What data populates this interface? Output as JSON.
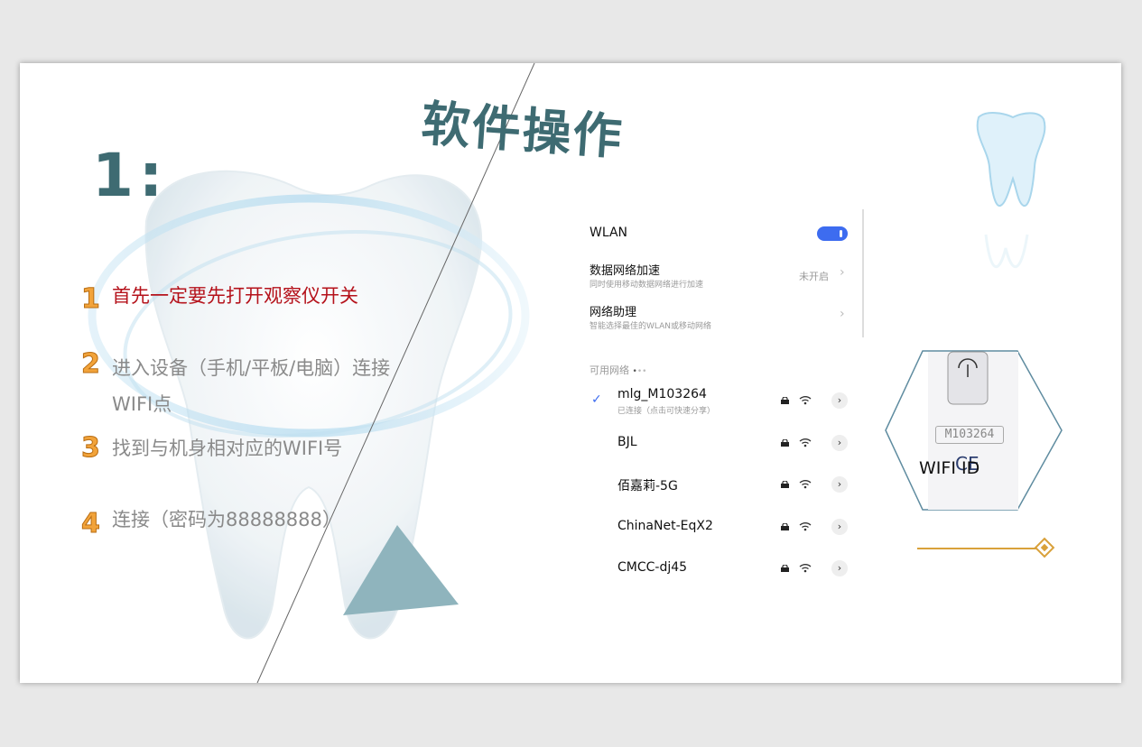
{
  "slide": {
    "step_number": "1:",
    "title": "软件操作"
  },
  "steps": [
    {
      "number": "1",
      "text": "首先一定要先打开观察仪开关"
    },
    {
      "number": "2",
      "text_line1": "进入设备（手机/平板/电脑）连接",
      "text_line2": "WIFI点"
    },
    {
      "number": "3",
      "text": "找到与机身相对应的WIFI号"
    },
    {
      "number": "4",
      "text": "连接（密码为88888888）"
    }
  ],
  "wlan_panel": {
    "wlan_label": "WLAN",
    "wlan_enabled": true,
    "data_accel_title": "数据网络加速",
    "data_accel_sub": "同时使用移动数据网络进行加速",
    "data_accel_status": "未开启",
    "assistant_title": "网络助理",
    "assistant_sub": "智能选择最佳的WLAN或移动网络",
    "available_label": "可用网络",
    "networks": [
      {
        "name": "mlg_M103264",
        "sub": "已连接（点击可快速分享）",
        "connected": true
      },
      {
        "name": "BJL",
        "sub": "",
        "connected": false
      },
      {
        "name": "佰嘉莉-5G",
        "sub": "",
        "connected": false
      },
      {
        "name": "ChinaNet-EqX2",
        "sub": "",
        "connected": false
      },
      {
        "name": "CMCC-dj45",
        "sub": "",
        "connected": false
      }
    ]
  },
  "device": {
    "serial_label": "M103264",
    "ce_mark": "CE",
    "caption": "WIFI ID"
  },
  "colors": {
    "title": "#3e6b72",
    "highlight_step": "#b5121b",
    "toggle": "#3d6cf0",
    "accent_line": "#d9a13a",
    "triangle": "#8fb4bd"
  },
  "icons": [
    "tooth-illustration",
    "tooth-icon",
    "lock-icon",
    "wifi-icon",
    "chevron-right-icon",
    "check-icon",
    "diamond-icon"
  ]
}
